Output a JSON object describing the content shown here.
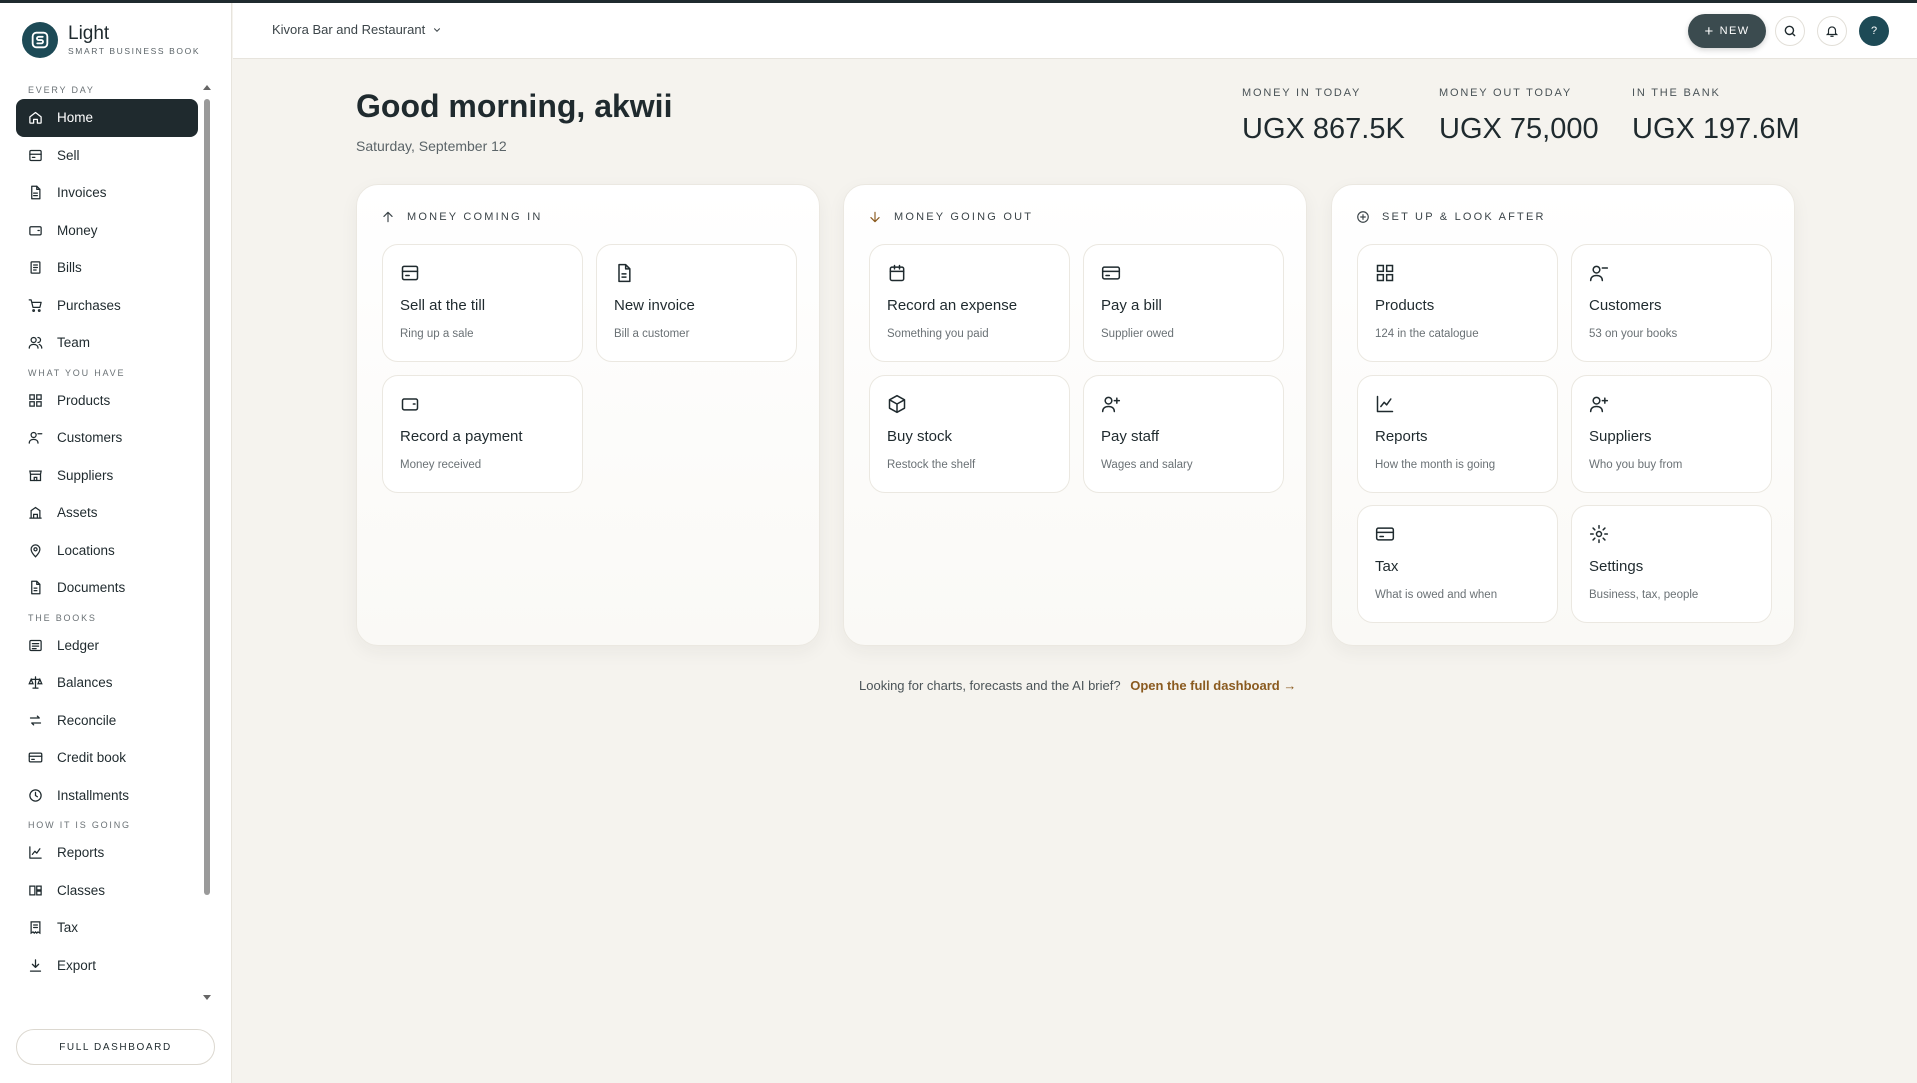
{
  "brand": {
    "name": "Light",
    "tagline": "SMART BUSINESS BOOK"
  },
  "sidebar": {
    "sections": [
      {
        "title": "EVERY DAY",
        "items": [
          {
            "label": "Home",
            "icon": "home-icon",
            "active": true
          },
          {
            "label": "Sell",
            "icon": "till-icon"
          },
          {
            "label": "Invoices",
            "icon": "invoice-icon"
          },
          {
            "label": "Money",
            "icon": "wallet-icon"
          },
          {
            "label": "Bills",
            "icon": "bill-icon"
          },
          {
            "label": "Purchases",
            "icon": "cart-icon"
          },
          {
            "label": "Team",
            "icon": "team-icon"
          }
        ]
      },
      {
        "title": "WHAT YOU HAVE",
        "items": [
          {
            "label": "Products",
            "icon": "grid-icon"
          },
          {
            "label": "Customers",
            "icon": "customers-icon"
          },
          {
            "label": "Suppliers",
            "icon": "store-icon"
          },
          {
            "label": "Assets",
            "icon": "building-icon"
          },
          {
            "label": "Locations",
            "icon": "pin-icon"
          },
          {
            "label": "Documents",
            "icon": "document-icon"
          }
        ]
      },
      {
        "title": "THE BOOKS",
        "items": [
          {
            "label": "Ledger",
            "icon": "ledger-icon"
          },
          {
            "label": "Balances",
            "icon": "scale-icon"
          },
          {
            "label": "Reconcile",
            "icon": "swap-icon"
          },
          {
            "label": "Credit book",
            "icon": "credit-icon"
          },
          {
            "label": "Installments",
            "icon": "clock-icon"
          }
        ]
      },
      {
        "title": "HOW IT IS GOING",
        "items": [
          {
            "label": "Reports",
            "icon": "chart-icon"
          },
          {
            "label": "Classes",
            "icon": "classes-icon"
          },
          {
            "label": "Tax",
            "icon": "receipt-icon"
          },
          {
            "label": "Export",
            "icon": "download-icon"
          }
        ]
      }
    ],
    "footer_button": "FULL DASHBOARD"
  },
  "topbar": {
    "business_name": "Kivora Bar and Restaurant",
    "new_label": "NEW",
    "avatar_initial": "?"
  },
  "header": {
    "greeting": "Good morning, akwii",
    "date": "Saturday, September 12"
  },
  "stats": [
    {
      "label": "MONEY IN TODAY",
      "value": "UGX 867.5K"
    },
    {
      "label": "MONEY OUT TODAY",
      "value": "UGX 75,000"
    },
    {
      "label": "IN THE BANK",
      "value": "UGX 197.6M"
    }
  ],
  "panels": [
    {
      "title": "MONEY COMING IN",
      "icon": "arrow-up-icon",
      "cards": [
        {
          "title": "Sell at the till",
          "sub": "Ring up a sale",
          "icon": "till-icon"
        },
        {
          "title": "New invoice",
          "sub": "Bill a customer",
          "icon": "invoice-icon"
        },
        {
          "title": "Record a payment",
          "sub": "Money received",
          "icon": "wallet-icon"
        }
      ]
    },
    {
      "title": "MONEY GOING OUT",
      "icon": "arrow-down-icon",
      "cards": [
        {
          "title": "Record an expense",
          "sub": "Something you paid",
          "icon": "calendar-icon"
        },
        {
          "title": "Pay a bill",
          "sub": "Supplier owed",
          "icon": "card-icon"
        },
        {
          "title": "Buy stock",
          "sub": "Restock the shelf",
          "icon": "box-icon"
        },
        {
          "title": "Pay staff",
          "sub": "Wages and salary",
          "icon": "user-plus-icon"
        }
      ]
    },
    {
      "title": "SET UP & LOOK AFTER",
      "icon": "plus-circle-icon",
      "cards": [
        {
          "title": "Products",
          "sub": "124 in the catalogue",
          "icon": "grid-icon"
        },
        {
          "title": "Customers",
          "sub": "53 on your books",
          "icon": "customers-icon"
        },
        {
          "title": "Reports",
          "sub": "How the month is going",
          "icon": "chart-icon"
        },
        {
          "title": "Suppliers",
          "sub": "Who you buy from",
          "icon": "user-plus-icon"
        },
        {
          "title": "Tax",
          "sub": "What is owed and when",
          "icon": "card-icon"
        },
        {
          "title": "Settings",
          "sub": "Business, tax, people",
          "icon": "gear-icon"
        }
      ]
    }
  ],
  "footer": {
    "prompt": "Looking for charts, forecasts and the AI brief?",
    "link": "Open the full dashboard →"
  },
  "colors": {
    "sidebar_active": "#1f2a2e",
    "brand": "#1d4a56",
    "link": "#8a5a1f",
    "background": "#f5f3ee"
  }
}
